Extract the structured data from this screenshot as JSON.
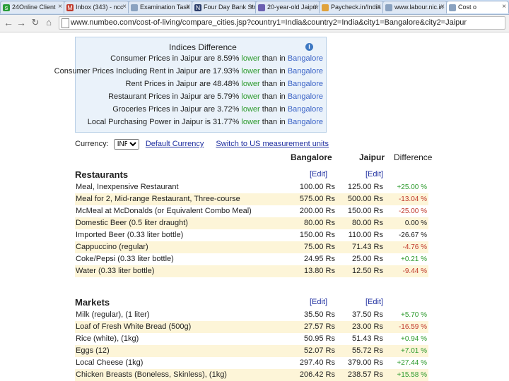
{
  "browser": {
    "tabs": [
      {
        "label": "24Online Client",
        "icon": "s",
        "icon_color": "#2a9d3a"
      },
      {
        "label": "Inbox (343) - ncc",
        "icon": "M",
        "icon_color": "#c0392b"
      },
      {
        "label": "Examination Task",
        "icon": "",
        "icon_color": "#8aa2c0"
      },
      {
        "label": "Four Day Bank Str",
        "icon": "N",
        "icon_color": "#2c3e6b"
      },
      {
        "label": "20-year-old Jaipur",
        "icon": "",
        "icon_color": "#6b5fb0"
      },
      {
        "label": "Paycheck.in/India",
        "icon": "",
        "icon_color": "#e0a23b"
      },
      {
        "label": "www.labour.nic.in",
        "icon": "",
        "icon_color": "#8aa2c0"
      },
      {
        "label": "Cost o",
        "icon": "",
        "icon_color": "#8aa2c0"
      }
    ],
    "url": "www.numbeo.com/cost-of-living/compare_cities.jsp?country1=India&country2=India&city1=Bangalore&city2=Jaipur"
  },
  "indices": {
    "title": "Indices Difference",
    "rows": [
      {
        "pre": "Consumer Prices in Jaipur are 8.59% ",
        "dir": "lower",
        "post": " than in ",
        "city": "Bangalore"
      },
      {
        "pre": "Consumer Prices Including Rent in Jaipur are 17.93% ",
        "dir": "lower",
        "post": " than in ",
        "city": "Bangalore"
      },
      {
        "pre": "Rent Prices in Jaipur are 48.48% ",
        "dir": "lower",
        "post": " than in ",
        "city": "Bangalore"
      },
      {
        "pre": "Restaurant Prices in Jaipur are 5.79% ",
        "dir": "lower",
        "post": " than in ",
        "city": "Bangalore"
      },
      {
        "pre": "Groceries Prices in Jaipur are 3.72% ",
        "dir": "lower",
        "post": " than in ",
        "city": "Bangalore"
      },
      {
        "pre": "Local Purchasing Power in Jaipur is 31.77% ",
        "dir": "lower",
        "post": " than in ",
        "city": "Bangalore"
      }
    ]
  },
  "currency": {
    "label": "Currency:",
    "selected": "INR",
    "default_link": "Default Currency",
    "units_link": "Switch to US measurement units"
  },
  "columns": {
    "city1": "Bangalore",
    "city2": "Jaipur",
    "diff": "Difference"
  },
  "edit_label": "[Edit]",
  "restaurants": {
    "title": "Restaurants",
    "rows": [
      {
        "item": "Meal, Inexpensive Restaurant",
        "v1": "100.00 Rs",
        "v2": "125.00 Rs",
        "d": "+25.00 %",
        "tone": "pos"
      },
      {
        "item": "Meal for 2, Mid-range Restaurant, Three-course",
        "v1": "575.00 Rs",
        "v2": "500.00 Rs",
        "d": "-13.04 %",
        "tone": "neg"
      },
      {
        "item": "McMeal at McDonalds (or Equivalent Combo Meal)",
        "v1": "200.00 Rs",
        "v2": "150.00 Rs",
        "d": "-25.00 %",
        "tone": "neg"
      },
      {
        "item": "Domestic Beer (0.5 liter draught)",
        "v1": "80.00 Rs",
        "v2": "80.00 Rs",
        "d": "0.00 %",
        "tone": "zero"
      },
      {
        "item": "Imported Beer (0.33 liter bottle)",
        "v1": "150.00 Rs",
        "v2": "110.00 Rs",
        "d": "-26.67 %",
        "tone": "negb"
      },
      {
        "item": "Cappuccino (regular)",
        "v1": "75.00 Rs",
        "v2": "71.43 Rs",
        "d": "-4.76 %",
        "tone": "neg"
      },
      {
        "item": "Coke/Pepsi (0.33 liter bottle)",
        "v1": "24.95 Rs",
        "v2": "25.00 Rs",
        "d": "+0.21 %",
        "tone": "pos"
      },
      {
        "item": "Water (0.33 liter bottle)",
        "v1": "13.80 Rs",
        "v2": "12.50 Rs",
        "d": "-9.44 %",
        "tone": "neg"
      }
    ]
  },
  "markets": {
    "title": "Markets",
    "rows": [
      {
        "item": "Milk (regular), (1 liter)",
        "v1": "35.50 Rs",
        "v2": "37.50 Rs",
        "d": "+5.70 %",
        "tone": "pos"
      },
      {
        "item": "Loaf of Fresh White Bread (500g)",
        "v1": "27.57 Rs",
        "v2": "23.00 Rs",
        "d": "-16.59 %",
        "tone": "neg"
      },
      {
        "item": "Rice (white), (1kg)",
        "v1": "50.95 Rs",
        "v2": "51.43 Rs",
        "d": "+0.94 %",
        "tone": "pos"
      },
      {
        "item": "Eggs (12)",
        "v1": "52.07 Rs",
        "v2": "55.72 Rs",
        "d": "+7.01 %",
        "tone": "pos"
      },
      {
        "item": "Local Cheese (1kg)",
        "v1": "297.40 Rs",
        "v2": "379.00 Rs",
        "d": "+27.44 %",
        "tone": "pos"
      },
      {
        "item": "Chicken Breasts (Boneless, Skinless), (1kg)",
        "v1": "206.42 Rs",
        "v2": "238.57 Rs",
        "d": "+15.58 %",
        "tone": "pos"
      }
    ]
  }
}
